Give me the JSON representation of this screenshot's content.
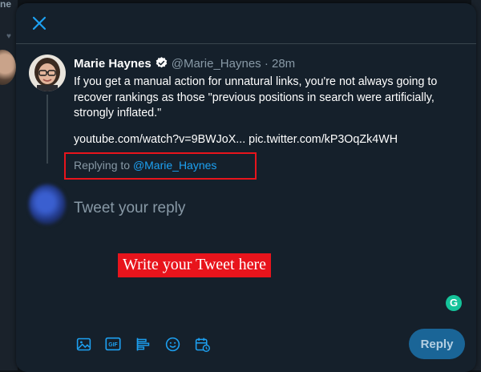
{
  "background": {
    "title_fragment": "ne"
  },
  "tweet": {
    "author_name": "Marie Haynes",
    "handle": "@Marie_Haynes",
    "separator": "·",
    "time_ago": "28m",
    "text": "If you get a manual action for unnatural links, you're not always going to recover rankings as those \"previous positions in search were artificially, strongly inflated.\"",
    "links": "youtube.com/watch?v=9BWJoX... pic.twitter.com/kP3OqZk4WH"
  },
  "replying": {
    "prefix": "Replying to",
    "target": "@Marie_Haynes"
  },
  "composer": {
    "placeholder": "Tweet your reply"
  },
  "annotation": {
    "text": "Write your Tweet here"
  },
  "grammarly": {
    "letter": "G"
  },
  "toolbar": {
    "gif_label": "GIF",
    "reply_label": "Reply"
  },
  "colors": {
    "modal_bg": "#15202b",
    "accent": "#1da1f2",
    "annotation_red": "#e8141c",
    "reply_button_disabled": "#1a6597",
    "grammarly": "#15c39a"
  },
  "icons": {
    "close": "close-icon",
    "verified": "verified-badge-icon",
    "media": "image-icon",
    "gif": "gif-icon",
    "poll": "poll-icon",
    "emoji": "emoji-icon",
    "schedule": "schedule-icon"
  }
}
